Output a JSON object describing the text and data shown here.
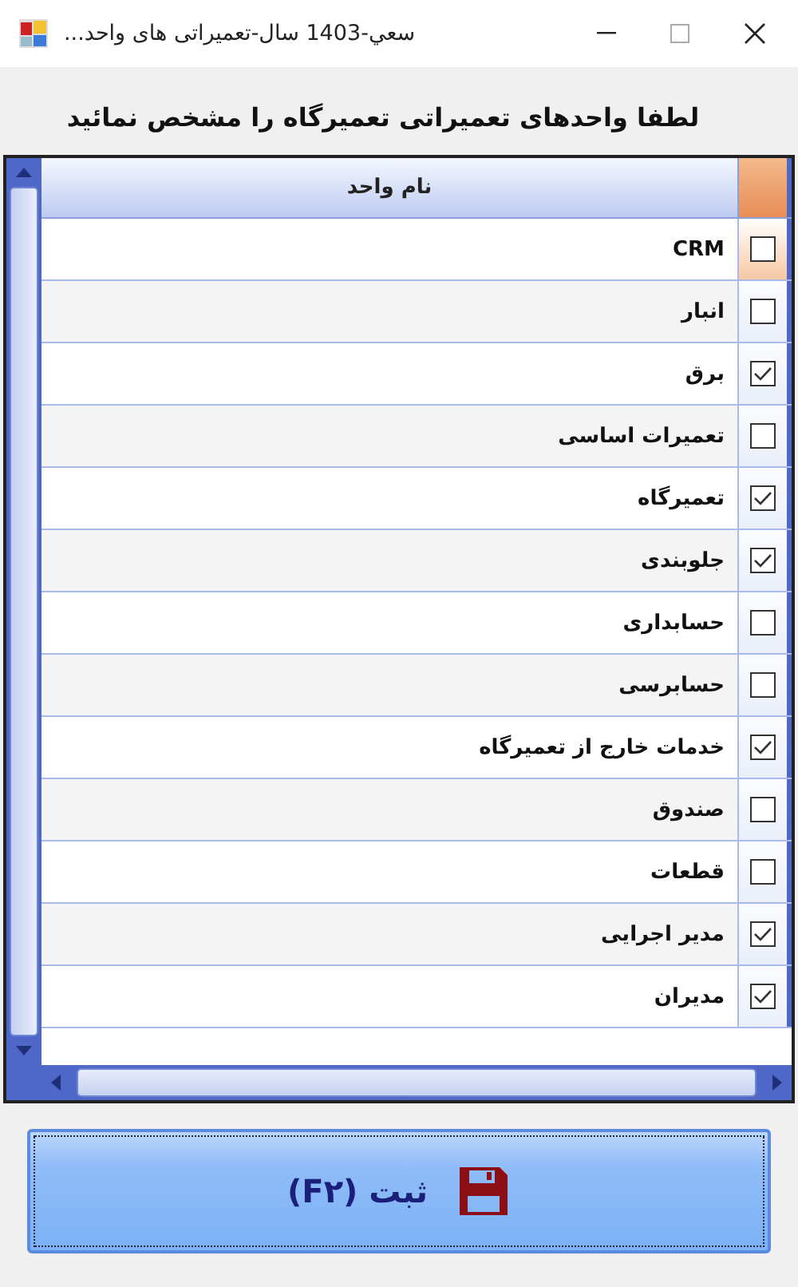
{
  "window": {
    "title": "سعي-1403 سال-تعمیراتی های واحد..."
  },
  "heading": "لطفا واحدهای تعمیراتی تعمیرگاه را مشخص نمائید",
  "table": {
    "columns": [
      "نام واحد"
    ],
    "rows": [
      {
        "name": "CRM",
        "checked": false,
        "selected": true
      },
      {
        "name": "انبار",
        "checked": false,
        "selected": false
      },
      {
        "name": "برق",
        "checked": true,
        "selected": false
      },
      {
        "name": "تعمیرات اساسی",
        "checked": false,
        "selected": false
      },
      {
        "name": "تعمیرگاه",
        "checked": true,
        "selected": false
      },
      {
        "name": "جلوبندی",
        "checked": true,
        "selected": false
      },
      {
        "name": "حسابداری",
        "checked": false,
        "selected": false
      },
      {
        "name": "حسابرسی",
        "checked": false,
        "selected": false
      },
      {
        "name": "خدمات خارج از تعمیرگاه",
        "checked": true,
        "selected": false
      },
      {
        "name": "صندوق",
        "checked": false,
        "selected": false
      },
      {
        "name": "قطعات",
        "checked": false,
        "selected": false
      },
      {
        "name": "مدیر اجرایی",
        "checked": true,
        "selected": false
      },
      {
        "name": "مدیران",
        "checked": true,
        "selected": false
      }
    ]
  },
  "submit_button": "ثبت (F۲)"
}
